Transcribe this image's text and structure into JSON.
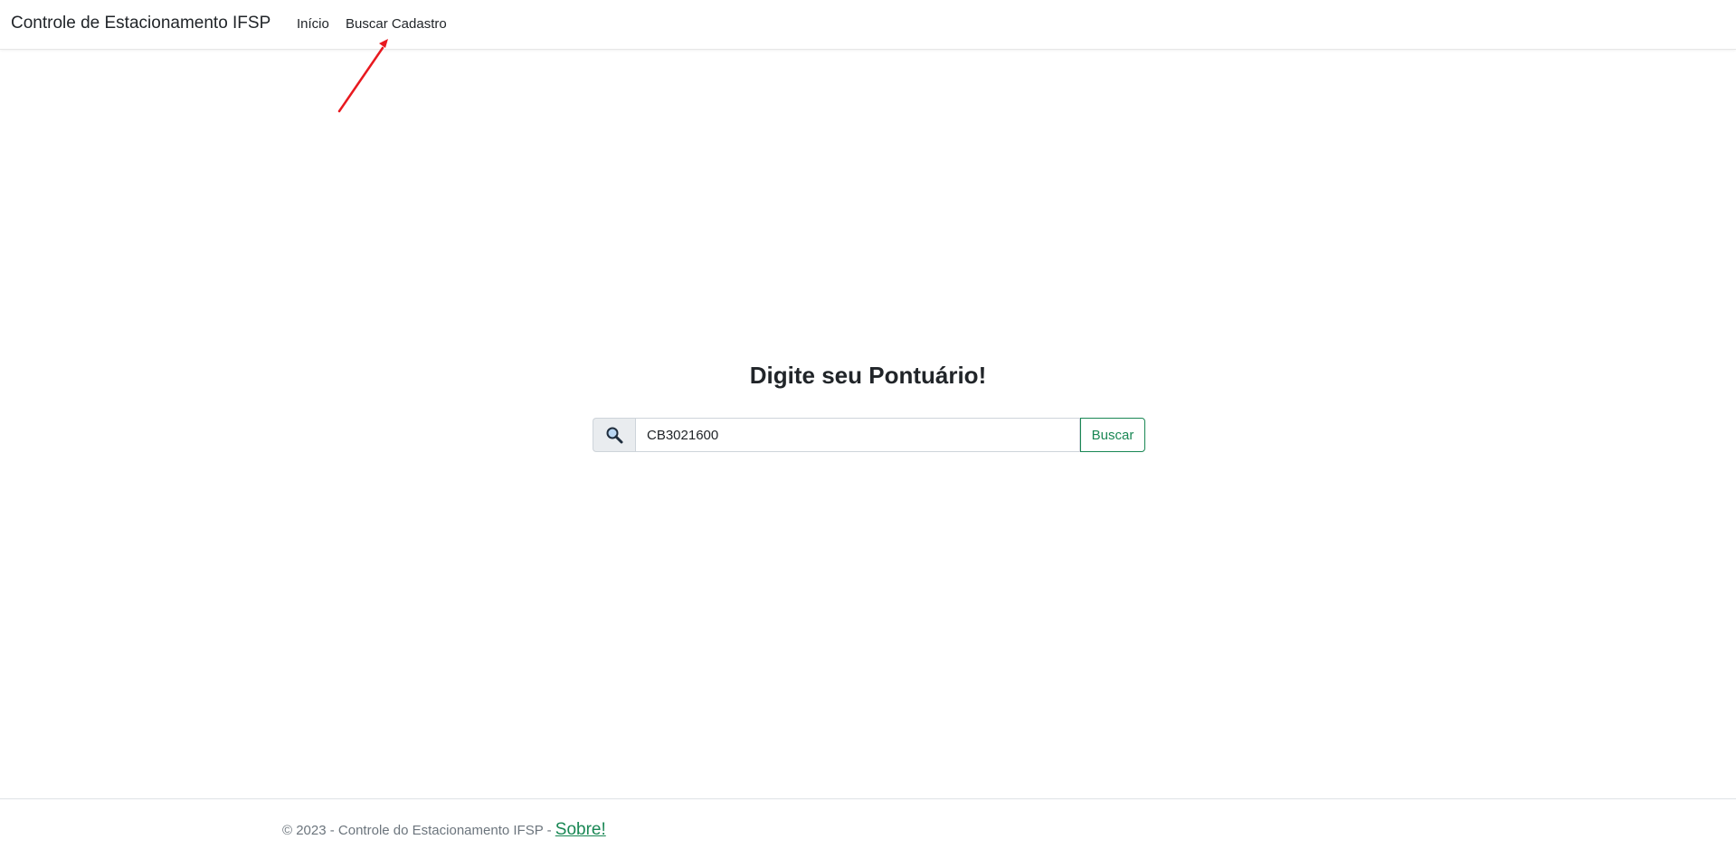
{
  "navbar": {
    "brand": "Controle de Estacionamento IFSP",
    "links": [
      {
        "label": "Início"
      },
      {
        "label": "Buscar Cadastro"
      }
    ]
  },
  "main": {
    "heading": "Digite seu Pontuário!",
    "search": {
      "value": "CB3021600",
      "button_label": "Buscar",
      "icon": "search-icon"
    }
  },
  "footer": {
    "text": "© 2023 - Controle do Estacionamento IFSP - ",
    "link_label": "Sobre!"
  },
  "colors": {
    "accent": "#198754",
    "annotation_arrow": "#e8191f"
  }
}
